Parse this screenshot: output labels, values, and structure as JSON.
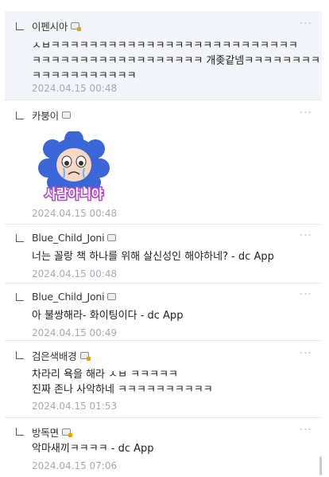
{
  "comments": [
    {
      "nick": "이펜시아",
      "body_lines": [
        "ㅅㅂㅋㅋㅋㅋㅋㅋㅋㅋㅋㅋㅋㅋㅋㅋㅋㅋㅋㅋㅋㅋㅋㅋㅋㅋㅋㅋ",
        "ㅋㅋㅋㅋㅋㅋㅋㅋㅋㅋㅋㅋㅋㅋㅋㅋㅋㅋ 개좆같넴ㅋㅋㅋㅋㅋㅋㅋㅋ",
        "ㅋㅋㅋㅋㅋㅋㅋㅋㅋㅋㅋ"
      ],
      "date": "2024.04.15 00:48"
    },
    {
      "nick": "카붕이",
      "sticker_text": "사람아니야",
      "date": "2024.04.15 00:48"
    },
    {
      "nick": "Blue_Child_Joni",
      "body_lines": [
        "너는 꼴랑 책 하나를 위해 살신성인 해야하네? - dc App"
      ],
      "date": "2024.04.15 00:48"
    },
    {
      "nick": "Blue_Child_Joni",
      "body_lines": [
        "아 불쌍해라- 화이팅이다 - dc App"
      ],
      "date": "2024.04.15 00:49"
    },
    {
      "nick": "검은색배경",
      "body_lines": [
        "차라리 욕을 해라 ㅅㅂ ㅋㅋㅋㅋㅋ",
        "진짜 존나 사악하네 ㅋㅋㅋㅋㅋㅋㅋㅋㅋㅋ"
      ],
      "date": "2024.04.15 01:53"
    },
    {
      "nick": "방독면",
      "body_lines": [
        "악마새끼ㅋㅋㅋㅋ - dc App"
      ],
      "date": "2024.04.15 07:06"
    }
  ],
  "more_label": "···",
  "colors": {
    "highlight_bg": "#f3f4fa",
    "date": "#a3a8b3",
    "divider": "#e6e8ee"
  }
}
